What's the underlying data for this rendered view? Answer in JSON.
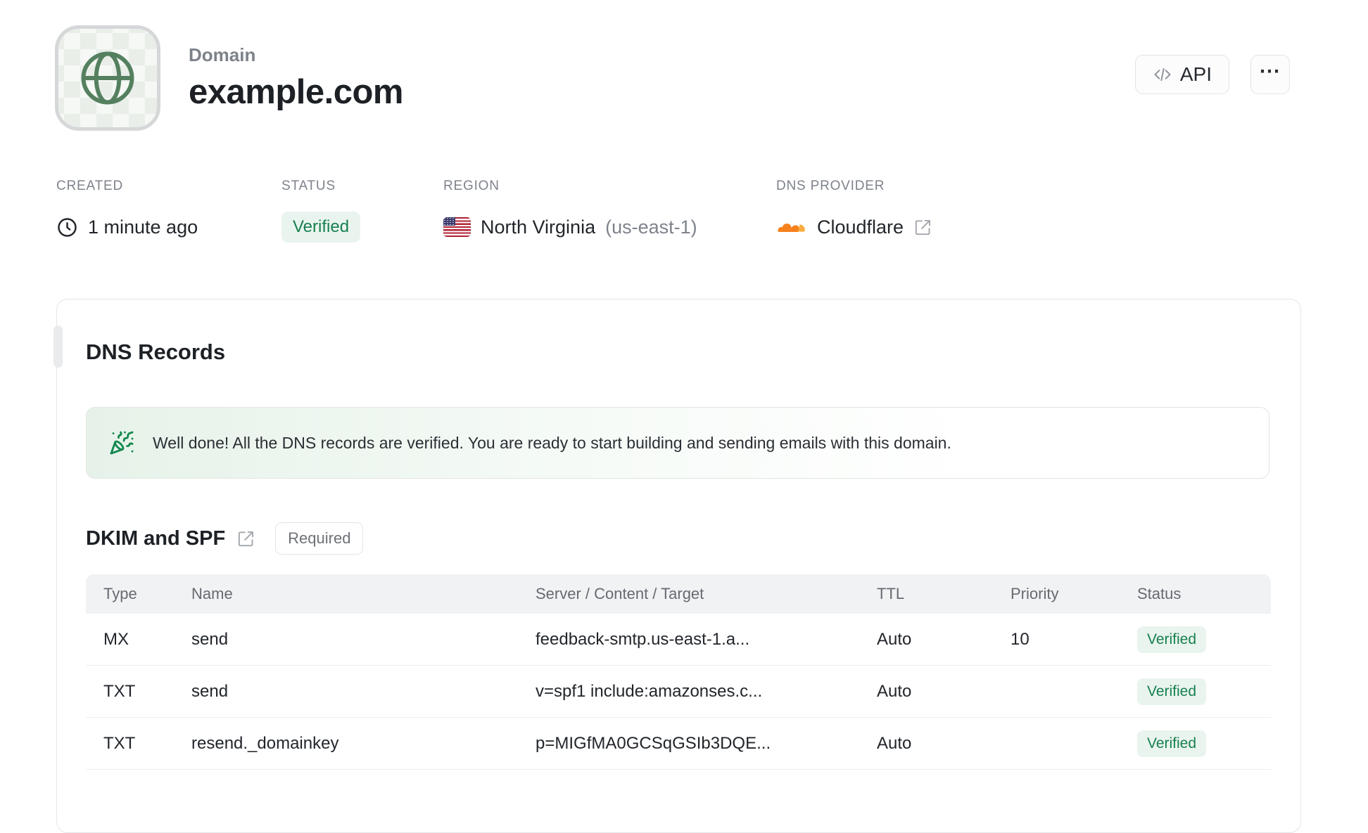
{
  "header": {
    "kicker": "Domain",
    "title": "example.com",
    "api_button": "API",
    "more_button": "⋯"
  },
  "meta": {
    "created": {
      "label": "CREATED",
      "value": "1 minute ago"
    },
    "status": {
      "label": "STATUS",
      "value": "Verified"
    },
    "region": {
      "label": "REGION",
      "value": "North Virginia",
      "code": "(us-east-1)"
    },
    "provider": {
      "label": "DNS PROVIDER",
      "value": "Cloudflare"
    }
  },
  "card": {
    "title": "DNS Records",
    "banner": {
      "text": "Well done! All the DNS records are verified. You are ready to start building and sending emails with this domain."
    },
    "section": {
      "title": "DKIM and SPF",
      "badge": "Required"
    },
    "table": {
      "headers": [
        "Type",
        "Name",
        "Server / Content / Target",
        "TTL",
        "Priority",
        "Status"
      ],
      "rows": [
        {
          "type": "MX",
          "name": "send",
          "content": "feedback-smtp.us-east-1.a...",
          "ttl": "Auto",
          "priority": "10",
          "status": "Verified"
        },
        {
          "type": "TXT",
          "name": "send",
          "content": "v=spf1 include:amazonses.c...",
          "ttl": "Auto",
          "priority": "",
          "status": "Verified"
        },
        {
          "type": "TXT",
          "name": "resend._domainkey",
          "content": "p=MIGfMA0GCSqGSIb3DQE...",
          "ttl": "Auto",
          "priority": "",
          "status": "Verified"
        }
      ]
    }
  },
  "icons": {
    "avatar": "globe-icon",
    "created": "clock-icon",
    "region": "us-flag-icon",
    "provider": "cloudflare-icon",
    "banner": "party-popper-icon",
    "api": "code-icon",
    "external": "external-link-icon"
  },
  "colors": {
    "accent_green": "#17804f",
    "badge_green_bg": "#eaf4ee",
    "banner_green_bg": "#e6f2e9",
    "cloudflare_orange": "#f6821f",
    "cloudflare_orange_light": "#fbad41",
    "flag_red": "#b22234",
    "flag_blue": "#3c3b6e",
    "border": "#e3e5e7",
    "text_dark": "#1d2126",
    "text_gray": "#7e838b"
  }
}
